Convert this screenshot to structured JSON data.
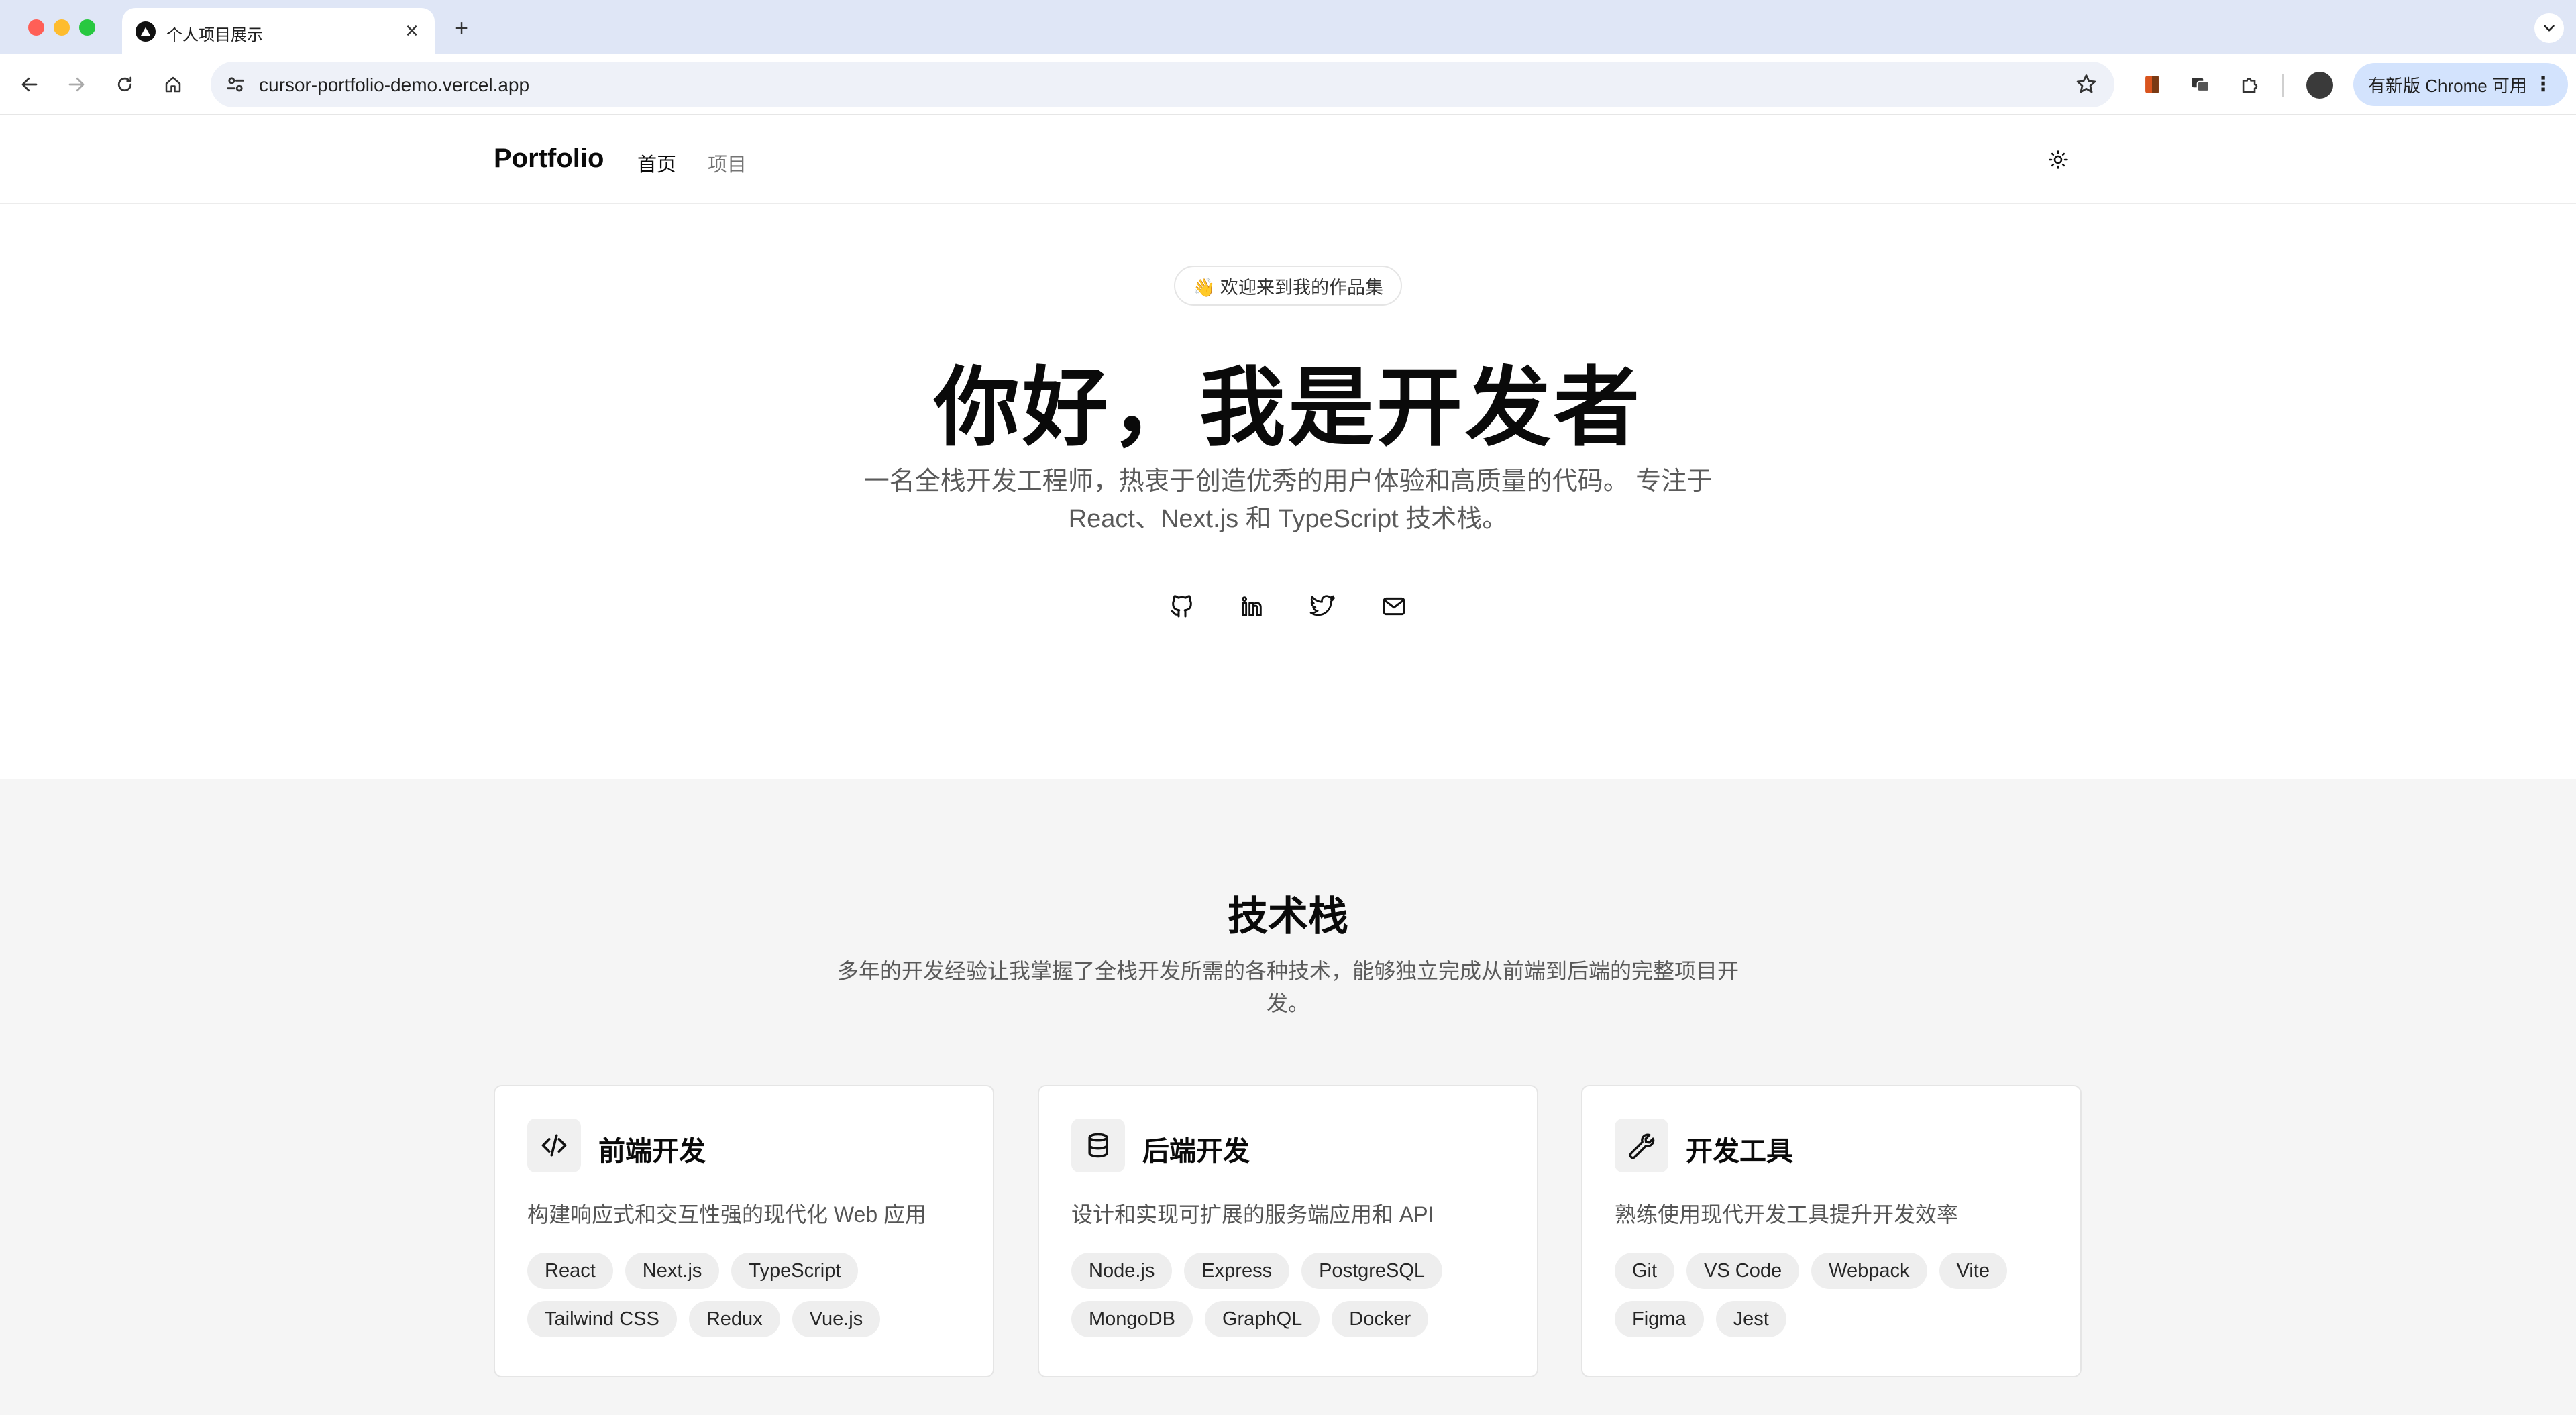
{
  "browser": {
    "tab_title": "个人项目展示",
    "tab_close": "✕",
    "new_tab": "+",
    "url": "cursor-portfolio-demo.vercel.app",
    "update_label": "有新版 Chrome 可用",
    "update_menu": "⋮"
  },
  "header": {
    "logo": "Portfolio",
    "nav": [
      "首页",
      "项目"
    ]
  },
  "hero": {
    "badge": "👋 欢迎来到我的作品集",
    "title": "你好，我是开发者",
    "description": "一名全栈开发工程师，热衷于创造优秀的用户体验和高质量的代码。 专注于 React、Next.js 和 TypeScript 技术栈。",
    "socials": [
      "github-icon",
      "linkedin-icon",
      "twitter-icon",
      "mail-icon"
    ]
  },
  "stack": {
    "title": "技术栈",
    "description": "多年的开发经验让我掌握了全栈开发所需的各种技术，能够独立完成从前端到后端的完整项目开发。",
    "cards": [
      {
        "icon": "code-icon",
        "title": "前端开发",
        "description": "构建响应式和交互性强的现代化 Web 应用",
        "tags": [
          "React",
          "Next.js",
          "TypeScript",
          "Tailwind CSS",
          "Redux",
          "Vue.js"
        ]
      },
      {
        "icon": "database-icon",
        "title": "后端开发",
        "description": "设计和实现可扩展的服务端应用和 API",
        "tags": [
          "Node.js",
          "Express",
          "PostgreSQL",
          "MongoDB",
          "GraphQL",
          "Docker"
        ]
      },
      {
        "icon": "wrench-icon",
        "title": "开发工具",
        "description": "熟练使用现代开发工具提升开发效率",
        "tags": [
          "Git",
          "VS Code",
          "Webpack",
          "Vite",
          "Figma",
          "Jest"
        ]
      }
    ]
  }
}
